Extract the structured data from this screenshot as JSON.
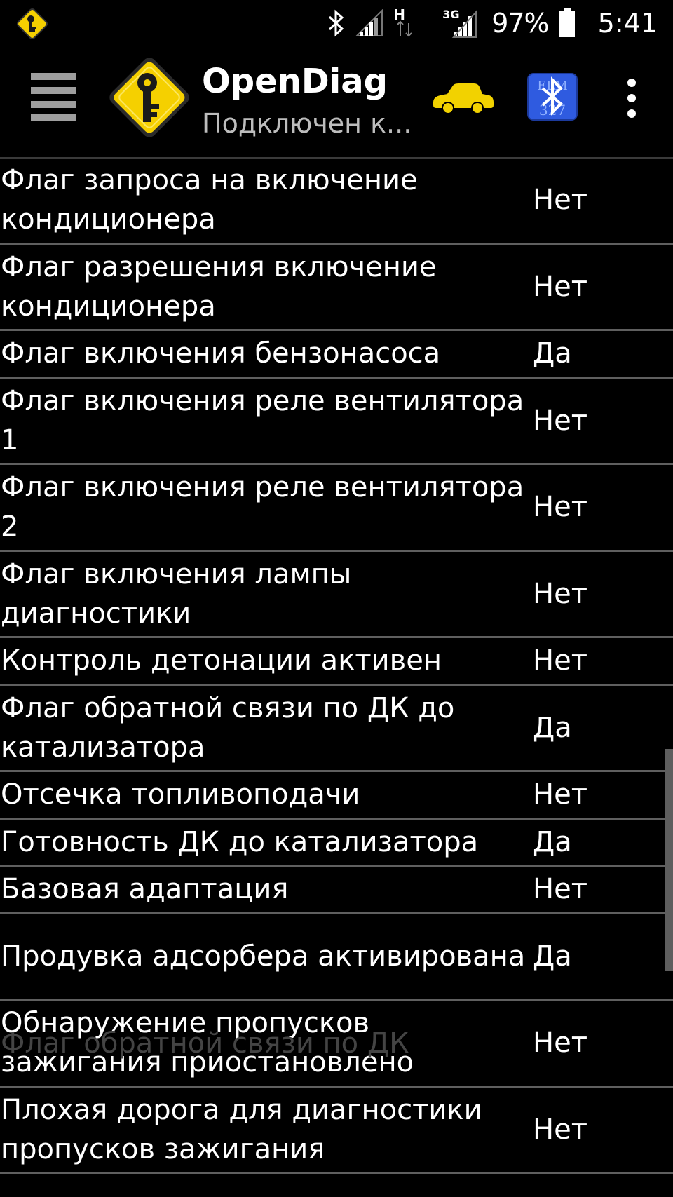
{
  "status_bar": {
    "network_type": "H",
    "network_type_2": "3G",
    "battery_percent": "97%",
    "time": "5:41",
    "icons": [
      "app-notification-icon",
      "bluetooth-icon",
      "signal-icon",
      "signal-3g-icon",
      "battery-icon"
    ]
  },
  "toolbar": {
    "title": "OpenDiag",
    "subtitle": "Подключен к...",
    "icons": [
      "hamburger-menu-icon",
      "app-logo-icon",
      "car-icon",
      "ecu-bluetooth-icon",
      "overflow-menu-icon"
    ],
    "colors": {
      "logo_yellow": "#f5d000",
      "car_yellow": "#f2d200",
      "ecu_blue": "#2f5be0"
    }
  },
  "parameters": [
    {
      "name": "Флаг запроса на включение кондиционера",
      "value": "Нет"
    },
    {
      "name": "Флаг разрешения включение кондиционера",
      "value": "Нет"
    },
    {
      "name": "Флаг включения бензонасоса",
      "value": "Да"
    },
    {
      "name": "Флаг включения реле вентилятора 1",
      "value": "Нет"
    },
    {
      "name": "Флаг включения реле вентилятора 2",
      "value": "Нет"
    },
    {
      "name": "Флаг включения лампы диагностики",
      "value": "Нет"
    },
    {
      "name": "Контроль детонации активен",
      "value": "Нет"
    },
    {
      "name": "Флаг обратной связи по ДК до катализатора",
      "value": "Да"
    },
    {
      "name": "Отсечка топливоподачи",
      "value": "Нет"
    },
    {
      "name": "Готовность ДК до катализатора",
      "value": "Да"
    },
    {
      "name": "Базовая адаптация",
      "value": "Нет"
    },
    {
      "name": "Продувка адсорбера активирована",
      "value": "Да"
    },
    {
      "name": "Обнаружение пропусков зажигания приостановлено",
      "value": "Нет"
    },
    {
      "name": "Плохая дорога для диагностики пропусков зажигания",
      "value": "Нет"
    }
  ],
  "partial_next_row": "Флаг обратной связи по ДК"
}
